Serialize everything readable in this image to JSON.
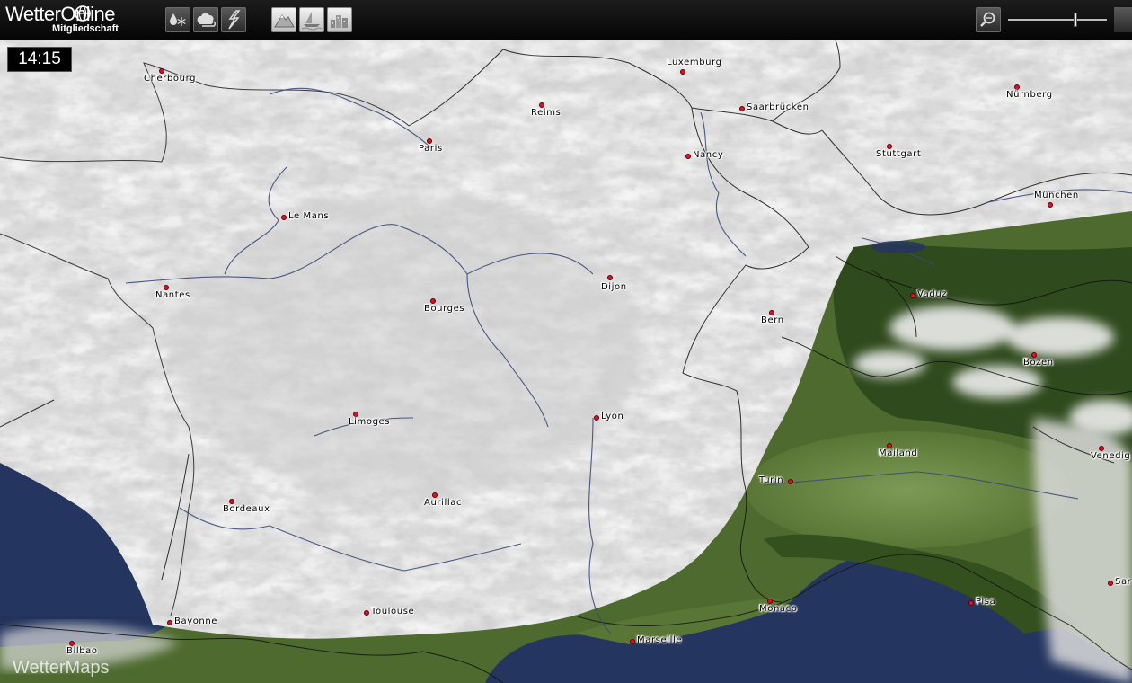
{
  "app": {
    "logo_text": "WetterOnline",
    "logo_subtitle": "Mitgliedschaft",
    "watermark": "WetterMaps"
  },
  "toolbar": {
    "left_buttons": [
      {
        "name": "precipitation-layer-button",
        "icon": "raindrop-snowflake-icon",
        "active": false
      },
      {
        "name": "cloud-layer-button",
        "icon": "cloud-icon",
        "active": false
      },
      {
        "name": "lightning-layer-button",
        "icon": "lightning-icon",
        "active": false
      }
    ],
    "view_buttons": [
      {
        "name": "terrain-view-button",
        "icon": "mountain-icon",
        "active": true
      },
      {
        "name": "sea-view-button",
        "icon": "ship-icon",
        "active": true
      },
      {
        "name": "city-view-button",
        "icon": "city-icon",
        "active": true
      }
    ],
    "zoom_level": 0.68
  },
  "map": {
    "time": "14:15",
    "colors": {
      "sea": "#24355f",
      "land": "#4e6a2e",
      "lowland": "#6c8847",
      "cloud": "#e6e6e6",
      "city_dot": "#e0102a"
    },
    "cities": [
      {
        "name": "Cherbourg"
      },
      {
        "name": "Luxemburg"
      },
      {
        "name": "Reims"
      },
      {
        "name": "Saarbrücken"
      },
      {
        "name": "Nürnberg"
      },
      {
        "name": "Paris"
      },
      {
        "name": "Nancy"
      },
      {
        "name": "Stuttgart"
      },
      {
        "name": "München"
      },
      {
        "name": "Le Mans"
      },
      {
        "name": "Dijon"
      },
      {
        "name": "Vaduz"
      },
      {
        "name": "Nantes"
      },
      {
        "name": "Bourges"
      },
      {
        "name": "Bern"
      },
      {
        "name": "Bozen"
      },
      {
        "name": "Limoges"
      },
      {
        "name": "Lyon"
      },
      {
        "name": "Mailand"
      },
      {
        "name": "Venedig"
      },
      {
        "name": "Turin"
      },
      {
        "name": "Bordeaux"
      },
      {
        "name": "Aurillac"
      },
      {
        "name": "Sar"
      },
      {
        "name": "Monaco"
      },
      {
        "name": "Pisa"
      },
      {
        "name": "Bayonne"
      },
      {
        "name": "Toulouse"
      },
      {
        "name": "Marseille"
      },
      {
        "name": "Bilbao"
      }
    ]
  }
}
